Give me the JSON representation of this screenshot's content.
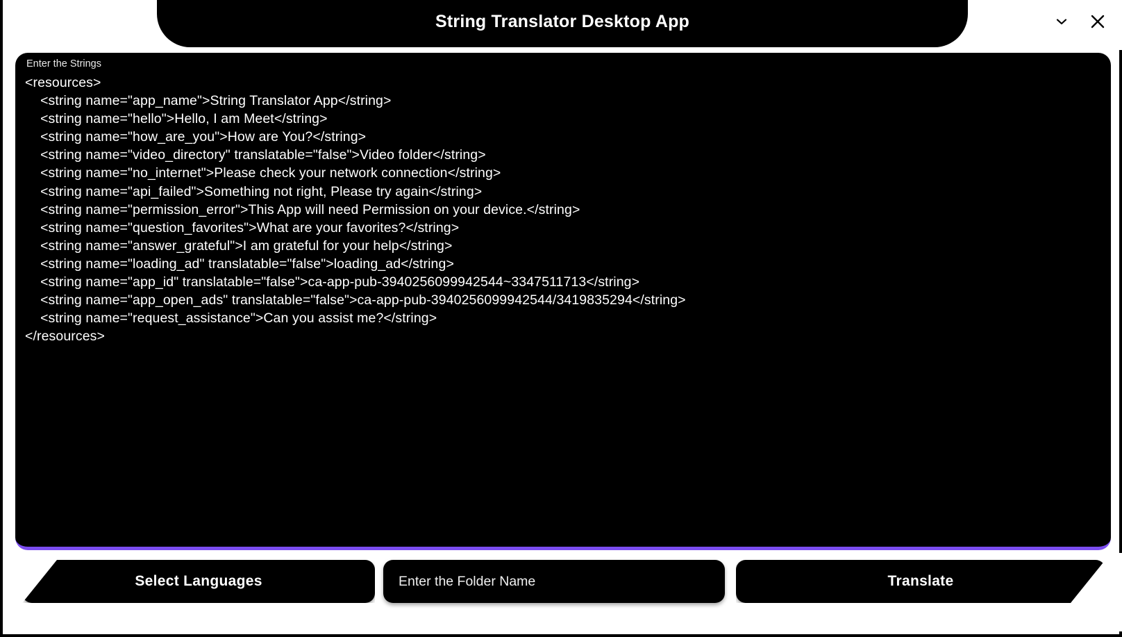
{
  "window": {
    "title": "String Translator Desktop App",
    "controls": [
      {
        "name": "chevron-down-icon",
        "label": "Minimize"
      },
      {
        "name": "close-icon",
        "label": "Close"
      }
    ]
  },
  "editor": {
    "label": "Enter the Strings",
    "content": "<resources>\n    <string name=\"app_name\">String Translator App</string>\n    <string name=\"hello\">Hello, I am Meet</string>\n    <string name=\"how_are_you\">How are You?</string>\n    <string name=\"video_directory\" translatable=\"false\">Video folder</string>\n    <string name=\"no_internet\">Please check your network connection</string>\n    <string name=\"api_failed\">Something not right, Please try again</string>\n    <string name=\"permission_error\">This App will need Permission on your device.</string>\n    <string name=\"question_favorites\">What are your favorites?</string>\n    <string name=\"answer_grateful\">I am grateful for your help</string>\n    <string name=\"loading_ad\" translatable=\"false\">loading_ad</string>\n    <string name=\"app_id\" translatable=\"false\">ca-app-pub-3940256099942544~3347511713</string>\n    <string name=\"app_open_ads\" translatable=\"false\">ca-app-pub-3940256099942544/3419835294</string>\n    <string name=\"request_assistance\">Can you assist me?</string>\n</resources>",
    "strings": [
      {
        "name": "app_name",
        "translatable": true,
        "value": "String Translator App"
      },
      {
        "name": "hello",
        "translatable": true,
        "value": "Hello, I am Meet"
      },
      {
        "name": "how_are_you",
        "translatable": true,
        "value": "How are You?"
      },
      {
        "name": "video_directory",
        "translatable": false,
        "value": "Video folder"
      },
      {
        "name": "no_internet",
        "translatable": true,
        "value": "Please check your network connection"
      },
      {
        "name": "api_failed",
        "translatable": true,
        "value": "Something not right, Please try again"
      },
      {
        "name": "permission_error",
        "translatable": true,
        "value": "This App will need Permission on your device."
      },
      {
        "name": "question_favorites",
        "translatable": true,
        "value": "What are your favorites?"
      },
      {
        "name": "answer_grateful",
        "translatable": true,
        "value": "I am grateful for your help"
      },
      {
        "name": "loading_ad",
        "translatable": false,
        "value": "loading_ad"
      },
      {
        "name": "app_id",
        "translatable": false,
        "value": "ca-app-pub-3940256099942544~3347511713"
      },
      {
        "name": "app_open_ads",
        "translatable": false,
        "value": "ca-app-pub-3940256099942544/3419835294"
      },
      {
        "name": "request_assistance",
        "translatable": true,
        "value": "Can you assist me?"
      }
    ]
  },
  "bottombar": {
    "select_languages_label": "Select Languages",
    "folder_placeholder": "Enter the Folder Name",
    "folder_value": "",
    "translate_label": "Translate"
  },
  "colors": {
    "accent_purple": "#7b4df0",
    "panel_black": "#000000",
    "page_white": "#ffffff",
    "text_white": "#ffffff"
  }
}
